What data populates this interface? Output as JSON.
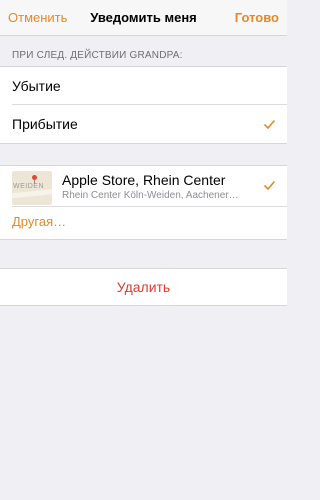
{
  "nav": {
    "cancel_label": "Отменить",
    "title": "Уведомить меня",
    "done_label": "Готово"
  },
  "trigger_section": {
    "header": "ПРИ СЛЕД. ДЕЙСТВИИ GRANDPA:",
    "options": [
      {
        "label": "Убытие",
        "selected": false
      },
      {
        "label": "Прибытие",
        "selected": true
      }
    ]
  },
  "location": {
    "map_label": "WEIDEN",
    "title": "Apple Store, Rhein Center",
    "subtitle": "Rhein Center Köln-Weiden, Aachener…",
    "selected": true,
    "other_label": "Другая…"
  },
  "delete_label": "Удалить",
  "colors": {
    "accent": "#e08a2b",
    "destructive": "#e03a30",
    "background": "#efeff4"
  }
}
